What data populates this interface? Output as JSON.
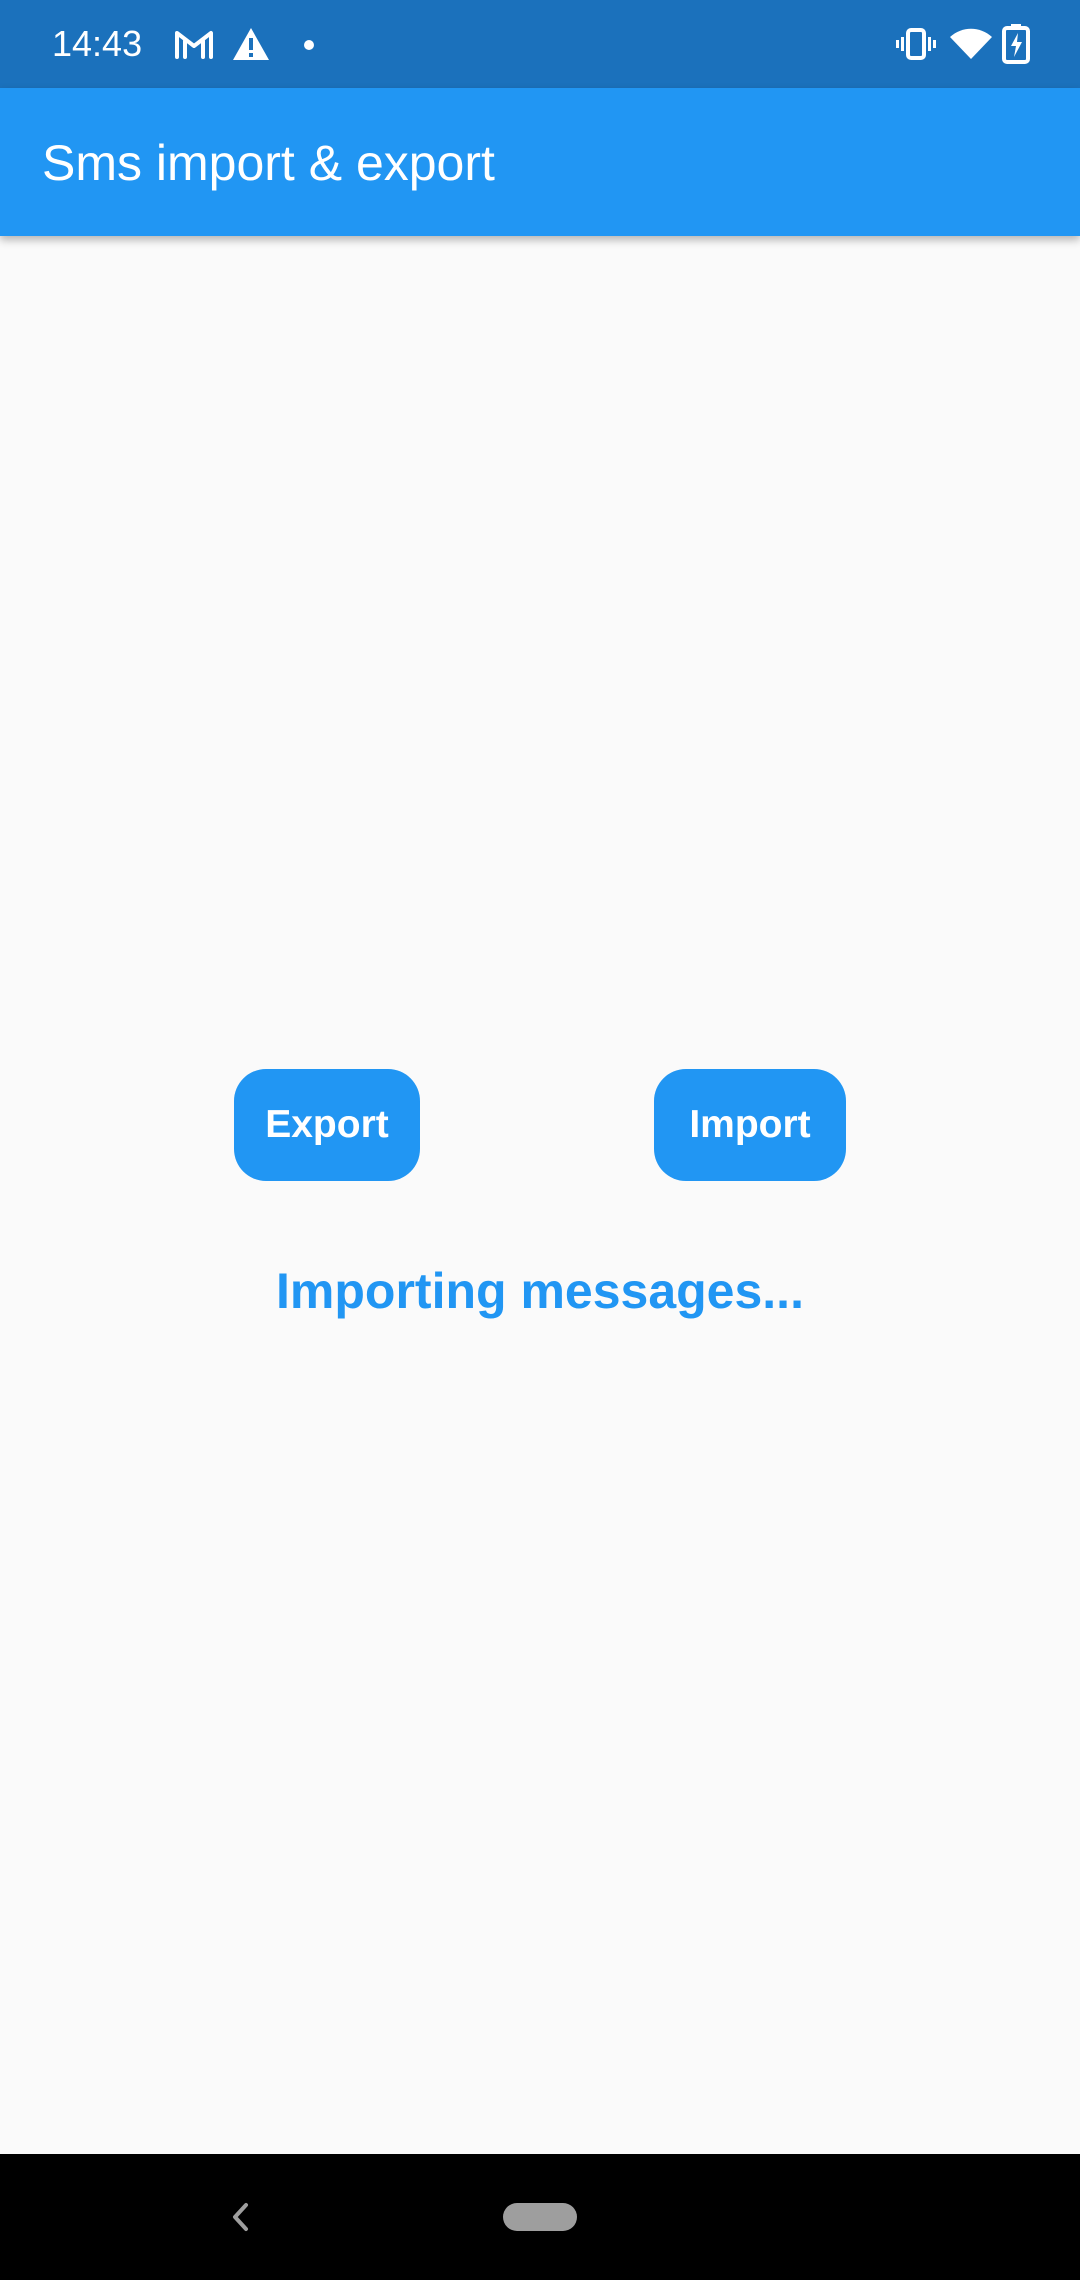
{
  "status_bar": {
    "time": "14:43",
    "icons": [
      "gmail-icon",
      "warning-icon",
      "notification-dot-icon",
      "vibrate-icon",
      "wifi-icon",
      "battery-charging-icon"
    ]
  },
  "app_bar": {
    "title": "Sms import & export",
    "color": "#2196f3"
  },
  "main": {
    "export_label": "Export",
    "import_label": "Import",
    "status_message": "Importing messages...",
    "accent_color": "#2196f3"
  },
  "nav_bar": {
    "icons": [
      "back-icon",
      "home-pill-icon"
    ]
  }
}
